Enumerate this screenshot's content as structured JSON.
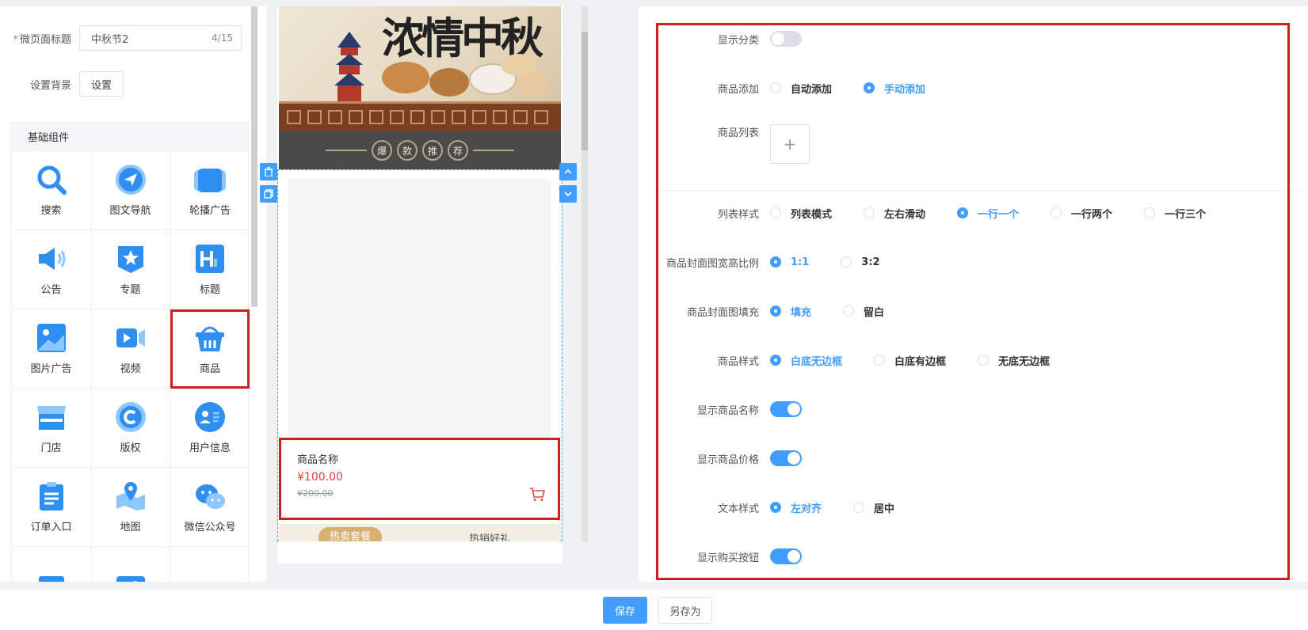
{
  "left_panel": {
    "page_title_label": "微页面标题",
    "page_title_required": "*",
    "page_title_value": "中秋节2",
    "page_title_count": "4/15",
    "background_label": "设置背景",
    "background_button": "设置",
    "components_header": "基础组件",
    "components": [
      {
        "label": "搜索",
        "icon": "search-icon"
      },
      {
        "label": "图文导航",
        "icon": "navigation-icon"
      },
      {
        "label": "轮播广告",
        "icon": "carousel-icon"
      },
      {
        "label": "公告",
        "icon": "announcement-icon"
      },
      {
        "label": "专题",
        "icon": "topic-icon"
      },
      {
        "label": "标题",
        "icon": "heading-icon"
      },
      {
        "label": "图片广告",
        "icon": "image-ad-icon"
      },
      {
        "label": "视频",
        "icon": "video-icon"
      },
      {
        "label": "商品",
        "icon": "basket-icon"
      },
      {
        "label": "门店",
        "icon": "store-icon"
      },
      {
        "label": "版权",
        "icon": "copyright-icon"
      },
      {
        "label": "用户信息",
        "icon": "user-info-icon"
      },
      {
        "label": "订单入口",
        "icon": "order-icon"
      },
      {
        "label": "地图",
        "icon": "map-icon"
      },
      {
        "label": "微信公众号",
        "icon": "wechat-icon"
      }
    ]
  },
  "preview": {
    "banner_text": "浓情中秋",
    "recommend_chars": [
      "爆",
      "款",
      "推",
      "荐"
    ],
    "product_name": "商品名称",
    "product_price": "¥100.00",
    "product_old_price": "¥200.00",
    "tab_active": "热卖套餐",
    "tab_other": "热销好礼"
  },
  "settings": {
    "show_category": {
      "label": "显示分类",
      "on": false
    },
    "product_add": {
      "label": "商品添加",
      "options": [
        "自动添加",
        "手动添加"
      ],
      "selected": 1
    },
    "product_list": {
      "label": "商品列表",
      "add_symbol": "+"
    },
    "list_style": {
      "label": "列表样式",
      "options": [
        "列表模式",
        "左右滑动",
        "一行一个",
        "一行两个",
        "一行三个"
      ],
      "selected": 2
    },
    "cover_ratio": {
      "label": "商品封面图宽高比例",
      "options": [
        "1:1",
        "3:2"
      ],
      "selected": 0
    },
    "cover_fill": {
      "label": "商品封面图填充",
      "options": [
        "填充",
        "留白"
      ],
      "selected": 0
    },
    "product_style": {
      "label": "商品样式",
      "options": [
        "白底无边框",
        "白底有边框",
        "无底无边框"
      ],
      "selected": 0
    },
    "show_name": {
      "label": "显示商品名称",
      "on": true
    },
    "show_price": {
      "label": "显示商品价格",
      "on": true
    },
    "text_style": {
      "label": "文本样式",
      "options": [
        "左对齐",
        "居中"
      ],
      "selected": 0
    },
    "show_buy": {
      "label": "显示购买按钮",
      "on": true
    }
  },
  "footer": {
    "save": "保存",
    "save_as": "另存为"
  },
  "colors": {
    "accent": "#409eff",
    "highlight": "#d11f1f",
    "price": "#e64340"
  }
}
